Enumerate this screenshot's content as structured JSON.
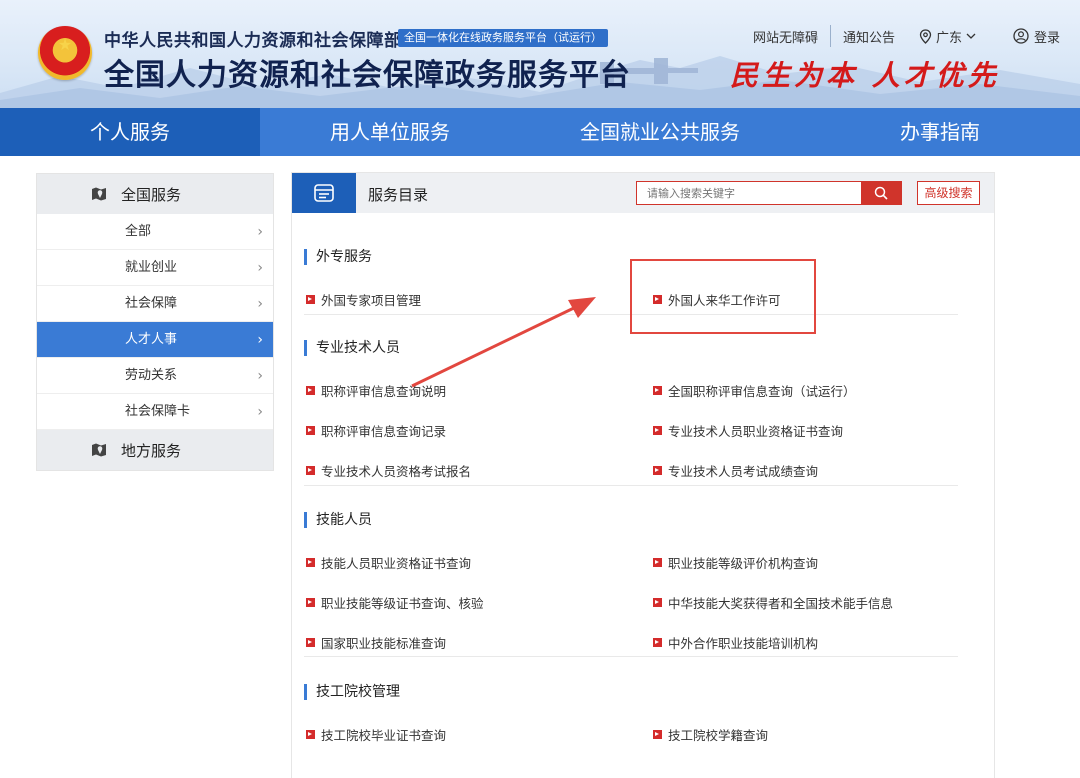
{
  "header": {
    "ministry_name": "中华人民共和国人力资源和社会保障部",
    "pilot_badge": "全国一体化在线政务服务平台（试运行）",
    "platform_name": "全国人力资源和社会保障政务服务平台",
    "links": {
      "accessibility": "网站无障碍",
      "notice": "通知公告",
      "region": "广东",
      "login": "登录"
    },
    "slogan": "民生为本 人才优先"
  },
  "nav": {
    "items": [
      "个人服务",
      "用人单位服务",
      "全国就业公共服务",
      "办事指南"
    ],
    "active_index": 0
  },
  "sidebar": {
    "national_title": "全国服务",
    "items": [
      "全部",
      "就业创业",
      "社会保障",
      "人才人事",
      "劳动关系",
      "社会保障卡"
    ],
    "active_index": 3,
    "local_title": "地方服务"
  },
  "panel": {
    "title": "服务目录",
    "search_placeholder": "请输入搜索关键字",
    "advanced_search": "高级搜索",
    "sections": [
      {
        "title": "外专服务",
        "services": [
          "外国专家项目管理",
          "外国人来华工作许可"
        ]
      },
      {
        "title": "专业技术人员",
        "services": [
          "职称评审信息查询说明",
          "全国职称评审信息查询（试运行）",
          "职称评审信息查询记录",
          "专业技术人员职业资格证书查询",
          "专业技术人员资格考试报名",
          "专业技术人员考试成绩查询"
        ]
      },
      {
        "title": "技能人员",
        "services": [
          "技能人员职业资格证书查询",
          "职业技能等级评价机构查询",
          "职业技能等级证书查询、核验",
          "中华技能大奖获得者和全国技术能手信息",
          "国家职业技能标准查询",
          "中外合作职业技能培训机构"
        ]
      },
      {
        "title": "技工院校管理",
        "services": [
          "技工院校毕业证书查询",
          "技工院校学籍查询"
        ]
      }
    ]
  },
  "colors": {
    "nav_bg": "#3a7bd5",
    "nav_active": "#1d5fb8",
    "accent_red": "#d0342b",
    "highlight": "#e2473f"
  }
}
